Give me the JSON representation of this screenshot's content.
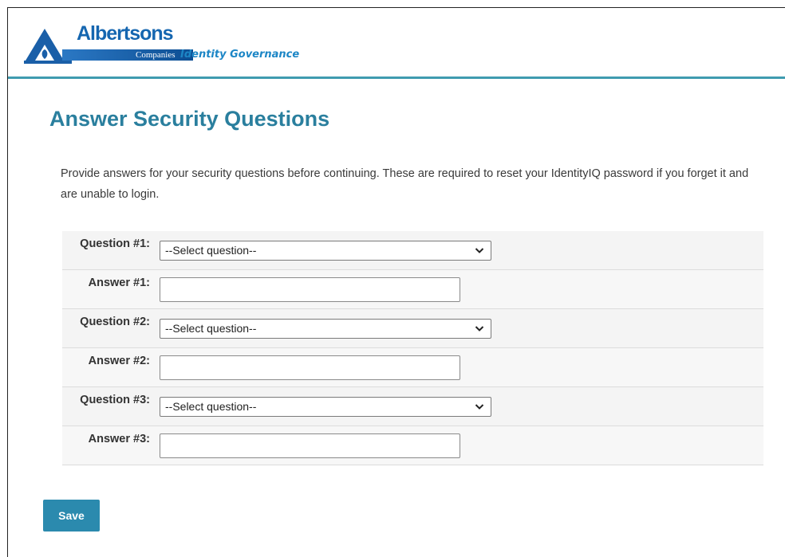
{
  "header": {
    "logo_name": "Albertsons",
    "logo_companies": "Companies",
    "product_name": "Identity Governance",
    "colors": {
      "brand_blue": "#1566b0",
      "accent_teal": "#3f9bb0"
    }
  },
  "page": {
    "title": "Answer Security Questions",
    "intro": "Provide answers for your security questions before continuing. These are required to reset your IdentityIQ password if you forget it and are unable to login."
  },
  "questions": [
    {
      "question_label": "Question #1:",
      "select_value": "--Select question--",
      "answer_label": "Answer #1:",
      "answer_value": ""
    },
    {
      "question_label": "Question #2:",
      "select_value": "--Select question--",
      "answer_label": "Answer #2:",
      "answer_value": ""
    },
    {
      "question_label": "Question #3:",
      "select_value": "--Select question--",
      "answer_label": "Answer #3:",
      "answer_value": ""
    }
  ],
  "actions": {
    "save_label": "Save",
    "save_color": "#2b8aae"
  }
}
